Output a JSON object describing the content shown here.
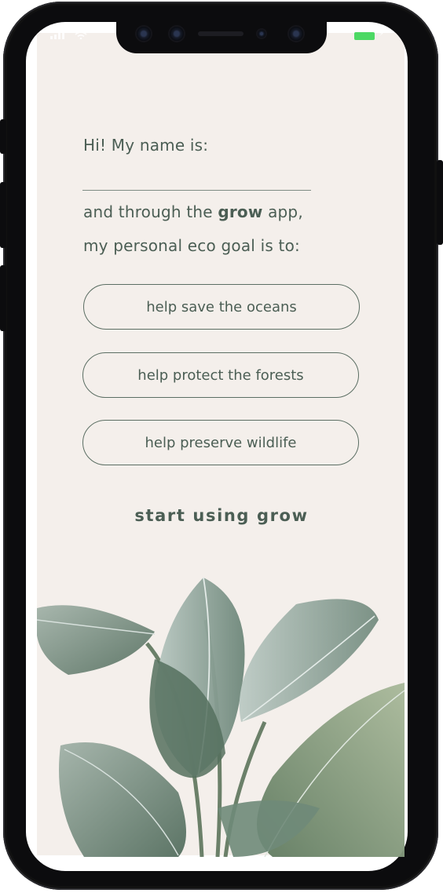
{
  "status_bar": {
    "signal_icon": "signal-bars-icon",
    "wifi_icon": "wifi-icon",
    "battery_icon": "battery-icon",
    "battery_color": "#4cd964"
  },
  "intro": {
    "name_prompt": "Hi! My name is:",
    "name_value": "",
    "line_pre": "and through the ",
    "app_name": "grow",
    "line_post": " app,",
    "goal_prompt": "my personal eco goal is to:"
  },
  "goals": [
    {
      "label": "help save the oceans"
    },
    {
      "label": "help protect the forests"
    },
    {
      "label": "help preserve wildlife"
    }
  ],
  "cta": {
    "label": "start using grow"
  },
  "colors": {
    "background": "#f4efeb",
    "text": "#4b5e54",
    "outline": "#5b6e63",
    "leaf": "#6f8a79"
  },
  "decor": {
    "illustration": "banana-leaves-illustration"
  }
}
